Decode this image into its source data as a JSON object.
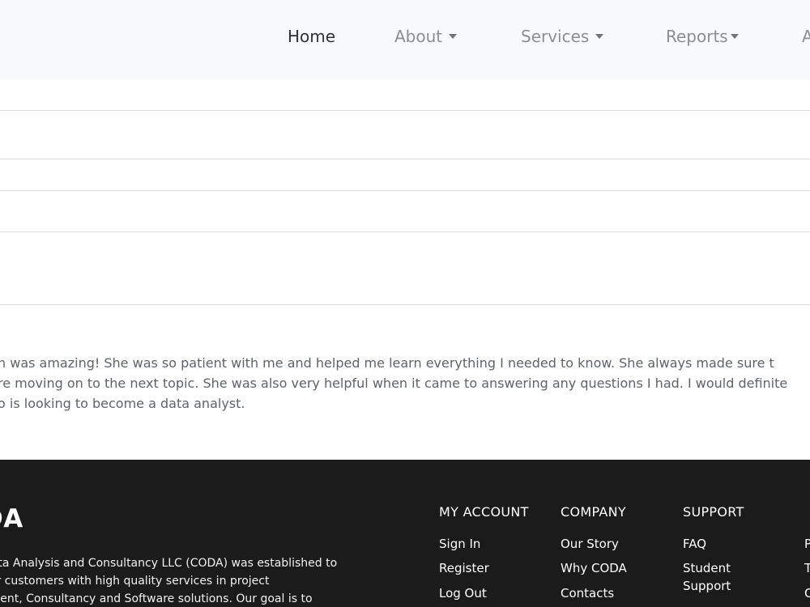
{
  "nav": {
    "home": "Home",
    "about": "About",
    "services": "Services",
    "reports": "Reports",
    "partial": "A"
  },
  "testimonial": {
    "line1": "h was amazing! She was so patient with me and helped me learn everything I needed to know. She always made sure t",
    "line2": "re moving on to the next topic. She was also very helpful when it came to answering any questions I had. I would definite",
    "line3": "o is looking to become a data analyst."
  },
  "footer": {
    "brand": "DA",
    "about_lines": [
      "Data Analysis and Consultancy LLC (CODA) was established to",
      "our customers with high quality services in project",
      "ement, Consultancy and Software solutions. Our goal is to"
    ],
    "my_account": {
      "title": "MY ACCOUNT",
      "links": [
        "Sign In",
        "Register",
        "Log Out"
      ]
    },
    "company": {
      "title": "COMPANY",
      "links": [
        "Our Story",
        "Why CODA",
        "Contacts"
      ]
    },
    "support": {
      "title": "SUPPORT",
      "links": [
        "FAQ",
        "Student Support"
      ]
    },
    "partial_col": {
      "links": [
        "P",
        "T",
        "C"
      ]
    }
  }
}
